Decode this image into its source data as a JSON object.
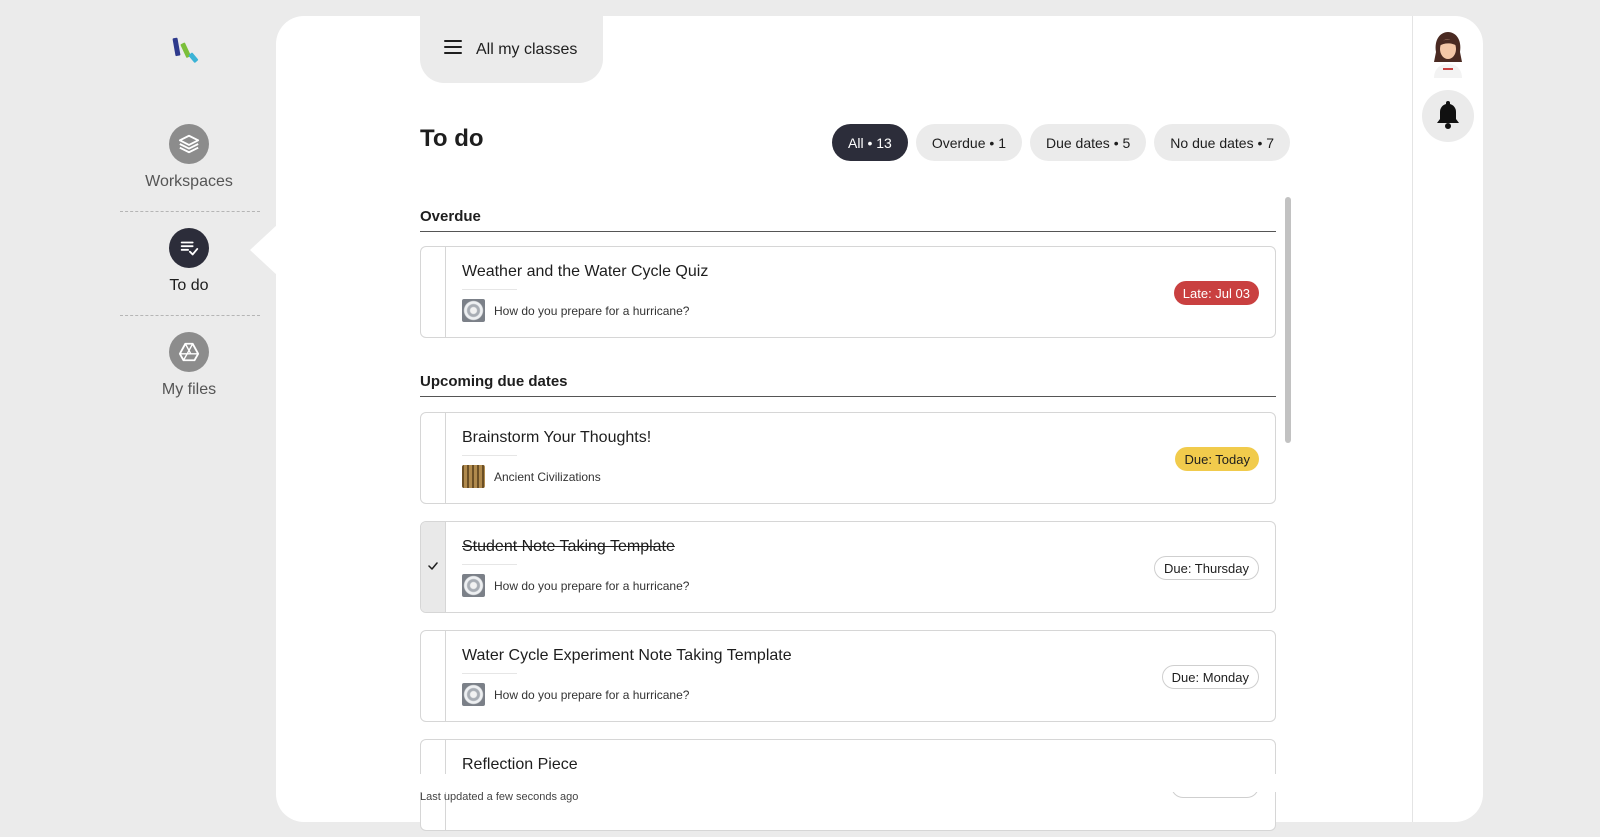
{
  "nav": {
    "items": [
      {
        "label": "Workspaces",
        "icon": "layers-icon"
      },
      {
        "label": "To do",
        "icon": "checklist-icon"
      },
      {
        "label": "My files",
        "icon": "drive-icon"
      }
    ]
  },
  "header": {
    "class_selector": "All my classes"
  },
  "page": {
    "title": "To do"
  },
  "filters": [
    {
      "label": "All • 13",
      "selected": true
    },
    {
      "label": "Overdue • 1",
      "selected": false
    },
    {
      "label": "Due dates • 5",
      "selected": false
    },
    {
      "label": "No due dates • 7",
      "selected": false
    }
  ],
  "sections": {
    "overdue": {
      "heading": "Overdue",
      "items": [
        {
          "title": "Weather and the Water Cycle Quiz",
          "class": "How do you prepare for a hurricane?",
          "badge": "Late: Jul 03",
          "status": "late",
          "done": false
        }
      ]
    },
    "upcoming": {
      "heading": "Upcoming due dates",
      "items": [
        {
          "title": "Brainstorm Your Thoughts!",
          "class": "Ancient Civilizations",
          "badge": "Due: Today",
          "status": "today",
          "done": false
        },
        {
          "title": "Student Note Taking Template",
          "class": "How do you prepare for a hurricane?",
          "badge": "Due: Thursday",
          "status": "plain",
          "done": true
        },
        {
          "title": "Water Cycle Experiment Note Taking Template",
          "class": "How do you prepare for a hurricane?",
          "badge": "Due: Monday",
          "status": "plain",
          "done": false
        },
        {
          "title": "Reflection Piece",
          "class": "",
          "badge": "",
          "status": "plain",
          "done": false
        }
      ]
    }
  },
  "footer": {
    "last_updated": "Last updated a few seconds ago"
  },
  "colors": {
    "late": "#c94040",
    "today": "#f1cb4c",
    "chip_selected": "#2c2d3a",
    "background": "#ebebeb"
  }
}
